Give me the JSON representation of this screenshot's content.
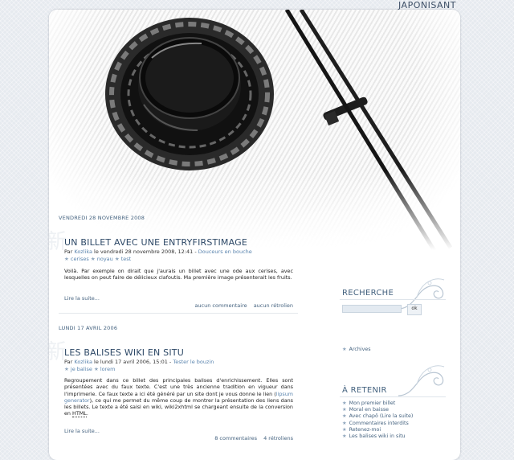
{
  "site": {
    "title": "JAPONISANT"
  },
  "posts": [
    {
      "date": "VENDREDI 28 NOVEMBRE 2008",
      "title": "UN BILLET AVEC UNE ENTRYFIRSTIMAGE",
      "meta_by": "Par",
      "author": "Kozlika",
      "meta_on": "le vendredi 28 novembre 2008, 12:41 -",
      "category": "Douceurs en bouche",
      "tags": [
        "cerises",
        "noyau",
        "test"
      ],
      "body": "Voilà. Par exemple on dirait que j'aurais un billet avec une ode aux cerises, avec lesquelles on peut faire de délicieux clafoutis. Ma première image présenterait les fruits.",
      "read_more": "Lire la suite...",
      "comments": "aucun commentaire",
      "trackbacks": "aucun rétrolien"
    },
    {
      "date": "LUNDI 17 AVRIL 2006",
      "title": "LES BALISES WIKI EN SITU",
      "meta_by": "Par",
      "author": "Kozlika",
      "meta_on": "le lundi 17 avril 2006, 15:01 -",
      "category": "Tester le bouzin",
      "tags": [
        "je balise",
        "lorem"
      ],
      "body_part1": "Regroupement dans ce billet des principales balises d'enrichissement. Elles sont présentées avec du faux texte. C'est une très ancienne tradition en vigueur dans l'imprimerie. Ce faux texte a ici été généré par un site dont je vous donne le lien (",
      "body_link": "lipsum generator",
      "body_part2": "), ce qui me permet du même coup de montrer la présentation des liens dans les billets. Le texte a été saisi en wiki, wiki2xhtml se chargeant ensuite de la conversion en ",
      "body_abbr": "HTML",
      "body_end": ".",
      "read_more": "Lire la suite...",
      "comments": "8 commentaires",
      "trackbacks": "4 rétroliens"
    }
  ],
  "sidebar": {
    "search": {
      "heading": "RECHERCHE",
      "input_value": "",
      "button_label": "ok"
    },
    "archives": {
      "label": "Archives"
    },
    "remember": {
      "heading": "À RETENIR",
      "items": [
        "Mon premier billet",
        "Moral en baisse",
        "Avec chapô (Lire la suite)",
        "Commentaires interdits",
        "Retenez-moi",
        "Les balises wiki in situ"
      ]
    }
  },
  "colors": {
    "accent": "#44627f",
    "link": "#5a84ae",
    "background": "#e6eaef"
  },
  "icons": [
    "star-icon",
    "swirl-ornament-icon",
    "kanji-watermark-icon"
  ]
}
